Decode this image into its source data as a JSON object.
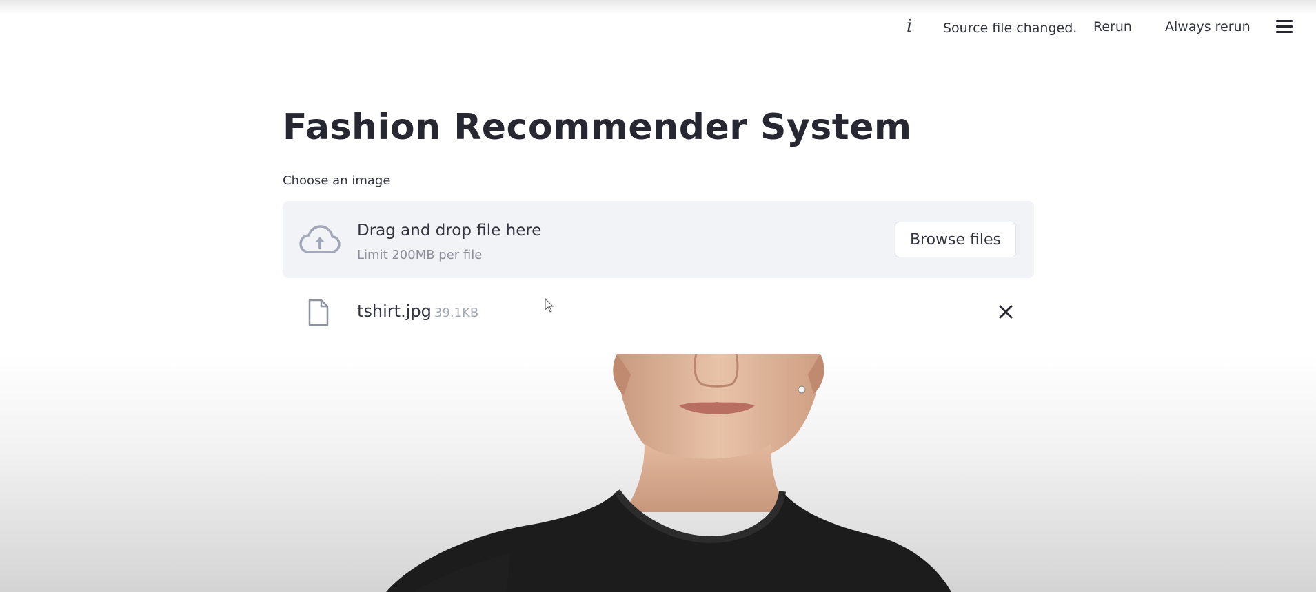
{
  "toolbar": {
    "info_icon": "info-icon",
    "status_text": "Source file changed.",
    "rerun_label": "Rerun",
    "always_rerun_label": "Always rerun",
    "menu_icon": "hamburger-menu-icon"
  },
  "main": {
    "title": "Fashion Recommender System",
    "uploader": {
      "label": "Choose an image",
      "drop_text": "Drag and drop file here",
      "limit_text": "Limit 200MB per file",
      "browse_label": "Browse files",
      "upload_icon": "cloud-upload-icon"
    },
    "uploaded_file": {
      "name": "tshirt.jpg",
      "size": "39.1KB",
      "file_icon": "file-icon",
      "remove_icon": "close-icon"
    }
  },
  "colors": {
    "text": "#262730",
    "dropzone_bg": "#f2f3f7",
    "muted_text": "#8b8d98"
  }
}
